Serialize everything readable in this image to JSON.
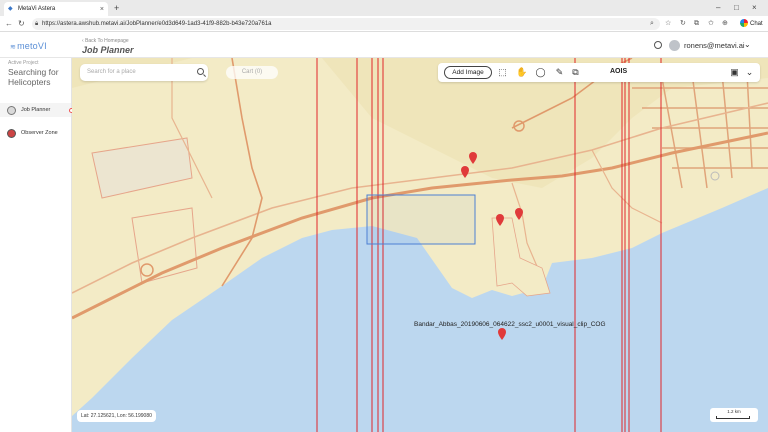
{
  "browser": {
    "tab_title": "MetaVi Astera",
    "url": "https://astera.awshub.metavi.ai/JobPlanner/e0d3d649-1ad3-41f9-882b-b43e720a761a",
    "chat_label": "Chat"
  },
  "header": {
    "logo_text": "metoVI",
    "back_link": "Back To Homepage",
    "page_title": "Job Planner",
    "user_email": "ronens@metavi.ai"
  },
  "sidebar": {
    "project_label": "Active Project",
    "project_name": "Searching for Helicopters",
    "items": [
      {
        "label": "Job Planner",
        "icon": "job-planner-icon",
        "active": true
      },
      {
        "label": "Observer Zone",
        "icon": "observer-icon",
        "active": false
      }
    ]
  },
  "map": {
    "search_placeholder": "Search for a place",
    "cart_label": "Cart (0)",
    "add_image_label": "Add Image",
    "aois_label": "AOIS",
    "coordinates": "Lat: 27.125621, Lon: 56.199080",
    "scale_label": "1.2 km",
    "image_label": "Bandar_Abbas_20190606_064622_ssc2_u0001_visual_clip_COG",
    "colors": {
      "footprint": "#e0262a",
      "aoi": "#4c7fd3",
      "marker": "#e03a3a",
      "road": "#e09a6c",
      "land": "#f3ebc6",
      "water": "#bcd7ef"
    }
  }
}
